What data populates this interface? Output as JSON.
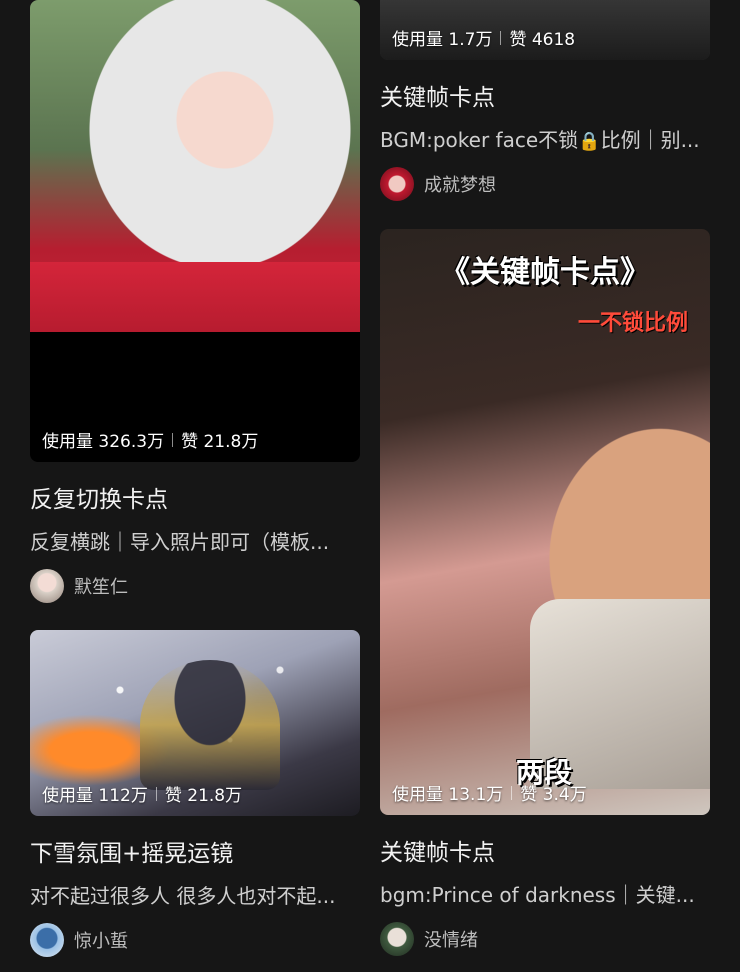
{
  "feed": {
    "cards": [
      {
        "stats": {
          "usage": "使用量 326.3万",
          "likes": "赞 21.8万"
        },
        "title": "反复切换卡点",
        "desc": "反复横跳｜导入照片即可（模板...",
        "author": "默笙仁"
      },
      {
        "stats": {
          "usage": "使用量 112万",
          "likes": "赞 21.8万"
        },
        "title": "下雪氛围+摇晃运镜",
        "desc": "对不起过很多人 很多人也对不起...",
        "author": "惊小蜇"
      },
      {
        "stats": {
          "usage": "使用量 1.7万",
          "likes": "赞 4618"
        },
        "title": "关键帧卡点",
        "desc_before": "BGM:poker face不锁",
        "lock_icon": "🔒",
        "desc_after": "比例｜别...",
        "author": "成就梦想"
      },
      {
        "overlay": {
          "title": "《关键帧卡点》",
          "subtitle": "一不锁比例",
          "bottom": "两段"
        },
        "stats": {
          "usage": "使用量 13.1万",
          "likes": "赞 3.4万"
        },
        "title": "关键帧卡点",
        "desc": "bgm:Prince of darkness｜关键...",
        "author": "没情绪"
      }
    ]
  },
  "colors": {
    "background": "#161616",
    "title": "#f2f2f2",
    "desc": "#cfcfcf",
    "author": "#bdbdbd"
  }
}
